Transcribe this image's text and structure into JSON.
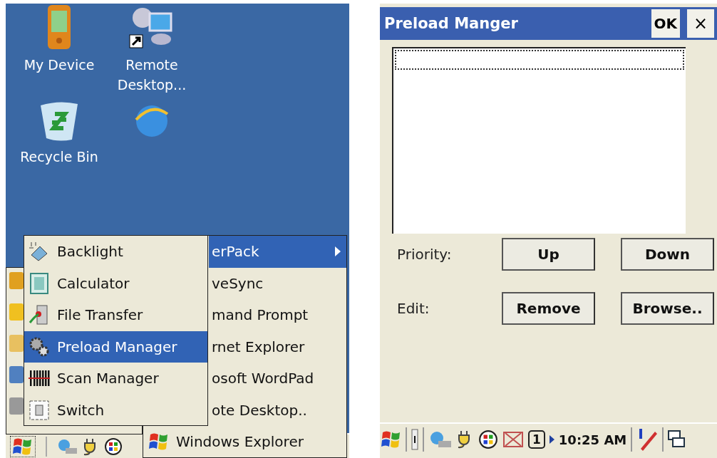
{
  "desktop": {
    "icons": [
      {
        "kind": "device",
        "label": "My Device"
      },
      {
        "kind": "remote",
        "label": "Remote Desktop..."
      },
      {
        "kind": "recycle",
        "label": "Recycle Bin"
      }
    ]
  },
  "programs_menu": {
    "items": [
      {
        "label": "erPack",
        "selected": true,
        "has_submenu": true
      },
      {
        "label": "veSync",
        "selected": false,
        "has_submenu": false
      },
      {
        "label": "mand Prompt",
        "selected": false,
        "has_submenu": false
      },
      {
        "label": "rnet Explorer",
        "selected": false,
        "has_submenu": false
      },
      {
        "label": "osoft WordPad",
        "selected": false,
        "has_submenu": false
      },
      {
        "label": "ote Desktop..",
        "selected": false,
        "has_submenu": false
      },
      {
        "label": "Windows Explorer",
        "selected": false,
        "has_submenu": false
      }
    ]
  },
  "submenu": {
    "items": [
      {
        "kind": "backlight",
        "label": "Backlight",
        "selected": false
      },
      {
        "kind": "calculator",
        "label": "Calculator",
        "selected": false
      },
      {
        "kind": "transfer",
        "label": "File Transfer",
        "selected": false
      },
      {
        "kind": "gears",
        "label": "Preload Manager",
        "selected": true
      },
      {
        "kind": "barcode",
        "label": "Scan Manager",
        "selected": false
      },
      {
        "kind": "switch",
        "label": "Switch",
        "selected": false
      }
    ]
  },
  "dialog": {
    "title": "Preload Manger",
    "ok": "OK",
    "close": "×",
    "list": {
      "focused": true
    },
    "rows": [
      {
        "label": "Priority:",
        "buttons": [
          "Up",
          "Down"
        ]
      },
      {
        "label": "Edit:",
        "buttons": [
          "Remove",
          "Browse.."
        ]
      }
    ]
  },
  "right_taskbar": {
    "input_number": "1",
    "time": "10:25 AM"
  }
}
